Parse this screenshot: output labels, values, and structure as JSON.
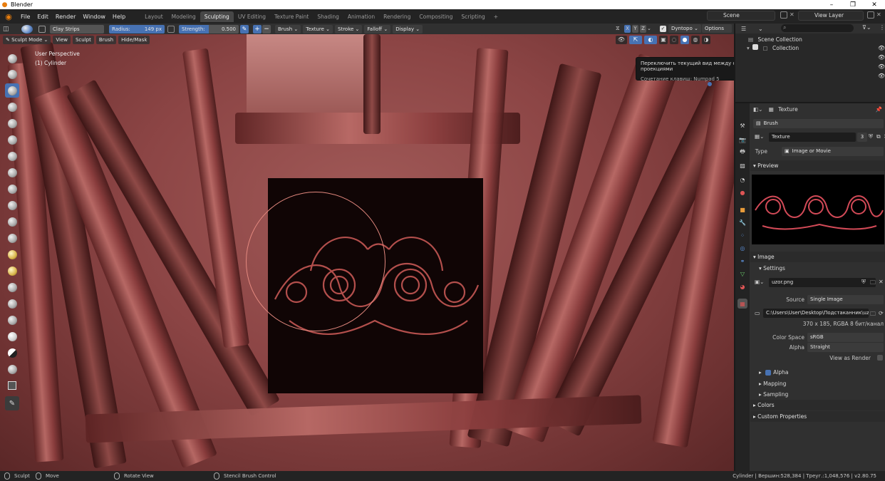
{
  "window": {
    "title": "Blender",
    "minimize": "–",
    "maximize": "❐",
    "close": "✕"
  },
  "menu": [
    "File",
    "Edit",
    "Render",
    "Window",
    "Help"
  ],
  "workspaces": [
    {
      "label": "Layout",
      "active": false
    },
    {
      "label": "Modeling",
      "active": false
    },
    {
      "label": "Sculpting",
      "active": true
    },
    {
      "label": "UV Editing",
      "active": false
    },
    {
      "label": "Texture Paint",
      "active": false
    },
    {
      "label": "Shading",
      "active": false
    },
    {
      "label": "Animation",
      "active": false
    },
    {
      "label": "Rendering",
      "active": false
    },
    {
      "label": "Compositing",
      "active": false
    },
    {
      "label": "Scripting",
      "active": false
    }
  ],
  "workspace_add": "+",
  "scene": "Scene",
  "view_layer": "View Layer",
  "tool_header": {
    "brush_name": "Clay Strips",
    "radius_label": "Radius:",
    "radius_value": "149 px",
    "strength_label": "Strength:",
    "strength_value": "0.500",
    "brush": "Brush",
    "texture": "Texture",
    "stroke": "Stroke",
    "falloff": "Falloff",
    "display": "Display",
    "axes": [
      "X",
      "Y",
      "Z"
    ],
    "dyntopo": "Dyntopo",
    "options": "Options"
  },
  "viewport_header": {
    "mode": "Sculpt Mode",
    "menus": [
      "View",
      "Sculpt",
      "Brush",
      "Hide/Mask"
    ]
  },
  "viewport": {
    "perspective": "User Perspective",
    "object": "(1) Cylinder"
  },
  "tooltip": {
    "title": "Переключить текущий вид между ортогональной и перспективной проекциями",
    "shortcut": "Сочетание клавиш: Numpad 5"
  },
  "outliner": {
    "search_placeholder": "",
    "rows": [
      "Scene Collection",
      "Collection"
    ]
  },
  "properties": {
    "header": "Texture",
    "context": "Brush",
    "texture_name": "Texture",
    "texture_users": "3",
    "type_label": "Type",
    "type_value": "Image or Movie",
    "preview_label": "Preview",
    "image_label": "Image",
    "settings_label": "Settings",
    "image_name": "uzor.png",
    "source_label": "Source",
    "source_value": "Single Image",
    "filepath": "C:\\Users\\User\\Desktop\\Подстаканник\\uz...",
    "image_info": "370 x 185,  RGBA 8 бит/канал",
    "color_space_label": "Color Space",
    "color_space_value": "sRGB",
    "alpha_label": "Alpha",
    "alpha_value": "Straight",
    "view_as_render": "View as Render",
    "sub_alpha": "Alpha",
    "sub_mapping": "Mapping",
    "sub_sampling": "Sampling",
    "colors": "Colors",
    "custom_properties": "Custom Properties"
  },
  "status": {
    "sculpt": "Sculpt",
    "move": "Move",
    "rotate": "Rotate View",
    "stencil": "Stencil Brush Control",
    "stats": "Cylinder | Вершин:528,384 | Треуг.:1,048,576 | v2.80.75"
  },
  "colors": {
    "accent": "#4772b3",
    "brand": "#e87d0d"
  }
}
